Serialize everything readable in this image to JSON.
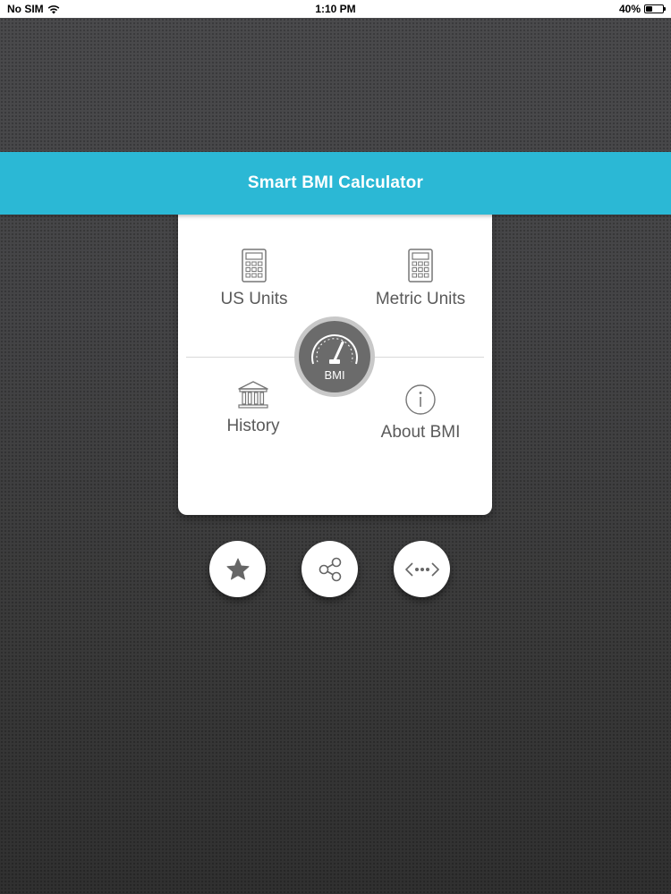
{
  "status_bar": {
    "carrier": "No SIM",
    "time": "1:10 PM",
    "battery": "40%",
    "battery_level": 0.4
  },
  "app": {
    "title": "Smart BMI Calculator",
    "accent_color": "#2bb8d5"
  },
  "menu": {
    "us_units": "US Units",
    "metric_units": "Metric Units",
    "history": "History",
    "about_bmi": "About BMI",
    "center_badge": "BMI"
  },
  "actions": {
    "favorite_icon": "star-icon",
    "share_icon": "share-icon",
    "more_icon": "more-icon"
  }
}
